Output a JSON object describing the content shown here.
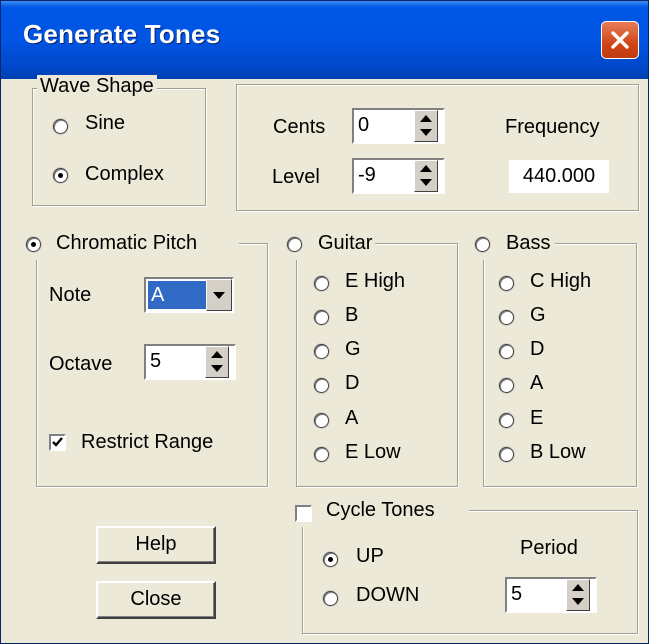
{
  "window": {
    "title": "Generate Tones"
  },
  "wave_shape": {
    "title": "Wave Shape",
    "options": [
      "Sine",
      "Complex"
    ],
    "selected": "Complex"
  },
  "cents": {
    "label": "Cents",
    "value": "0"
  },
  "level": {
    "label": "Level",
    "value": "-9"
  },
  "frequency": {
    "label": "Frequency",
    "value": "440.000"
  },
  "chromatic": {
    "title": "Chromatic Pitch",
    "selected": true,
    "note_label": "Note",
    "note_value": "A",
    "octave_label": "Octave",
    "octave_value": "5",
    "restrict_label": "Restrict Range",
    "restrict_checked": true
  },
  "guitar": {
    "title": "Guitar",
    "strings": [
      "E High",
      "B",
      "G",
      "D",
      "A",
      "E Low"
    ]
  },
  "bass": {
    "title": "Bass",
    "strings": [
      "C High",
      "G",
      "D",
      "A",
      "E",
      "B Low"
    ]
  },
  "cycle": {
    "title": "Cycle Tones",
    "checked": false,
    "up_label": "UP",
    "down_label": "DOWN",
    "direction": "UP",
    "period_label": "Period",
    "period_value": "5"
  },
  "buttons": {
    "help": "Help",
    "close": "Close"
  }
}
